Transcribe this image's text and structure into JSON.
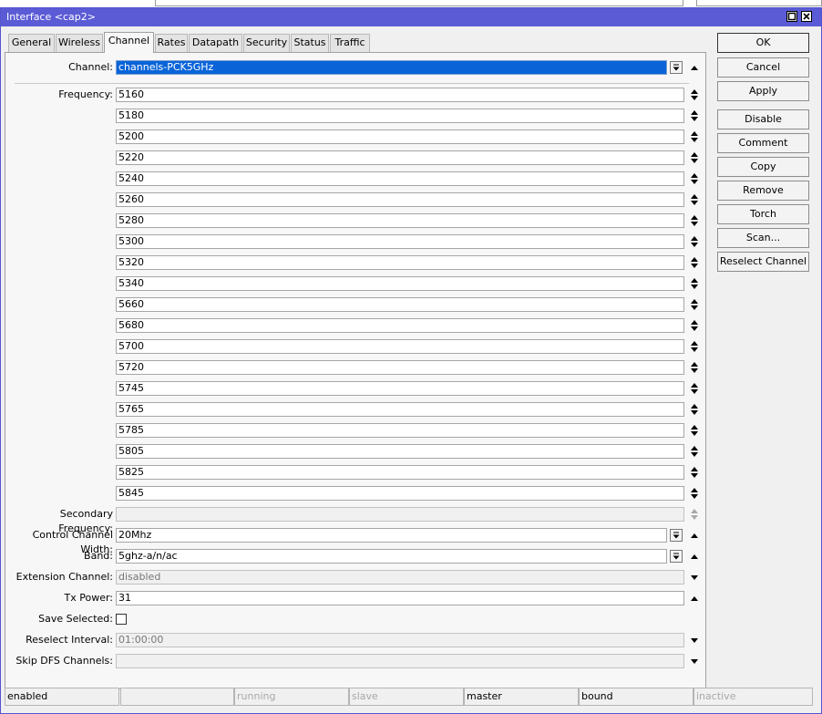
{
  "window": {
    "title": "Interface <cap2>"
  },
  "tabs": [
    {
      "label": "General"
    },
    {
      "label": "Wireless"
    },
    {
      "label": "Channel"
    },
    {
      "label": "Rates"
    },
    {
      "label": "Datapath"
    },
    {
      "label": "Security"
    },
    {
      "label": "Status"
    },
    {
      "label": "Traffic"
    }
  ],
  "form": {
    "channel": {
      "label": "Channel:",
      "value": "channels-PCK5GHz"
    },
    "frequency": {
      "label": "Frequency:",
      "values": [
        "5160",
        "5180",
        "5200",
        "5220",
        "5240",
        "5260",
        "5280",
        "5300",
        "5320",
        "5340",
        "5660",
        "5680",
        "5700",
        "5720",
        "5745",
        "5765",
        "5785",
        "5805",
        "5825",
        "5845"
      ]
    },
    "secondary_frequency": {
      "label": "Secondary Frequency:",
      "value": ""
    },
    "control_channel_width": {
      "label": "Control Channel Width:",
      "value": "20Mhz"
    },
    "band": {
      "label": "Band:",
      "value": "5ghz-a/n/ac"
    },
    "extension_channel": {
      "label": "Extension Channel:",
      "value": "disabled"
    },
    "tx_power": {
      "label": "Tx Power:",
      "value": "31"
    },
    "save_selected": {
      "label": "Save Selected:",
      "checked": false
    },
    "reselect_interval": {
      "label": "Reselect Interval:",
      "value": "01:00:00"
    },
    "skip_dfs_channels": {
      "label": "Skip DFS Channels:",
      "value": ""
    }
  },
  "buttons": {
    "ok": "OK",
    "cancel": "Cancel",
    "apply": "Apply",
    "disable": "Disable",
    "comment": "Comment",
    "copy": "Copy",
    "remove": "Remove",
    "torch": "Torch",
    "scan": "Scan...",
    "reselect_channel": "Reselect Channel"
  },
  "status_bar": [
    "enabled",
    "",
    "running",
    "slave",
    "master",
    "bound",
    "inactive"
  ],
  "colors": {
    "titlebar": "#5b5bd6",
    "selection": "#0a64d8"
  }
}
